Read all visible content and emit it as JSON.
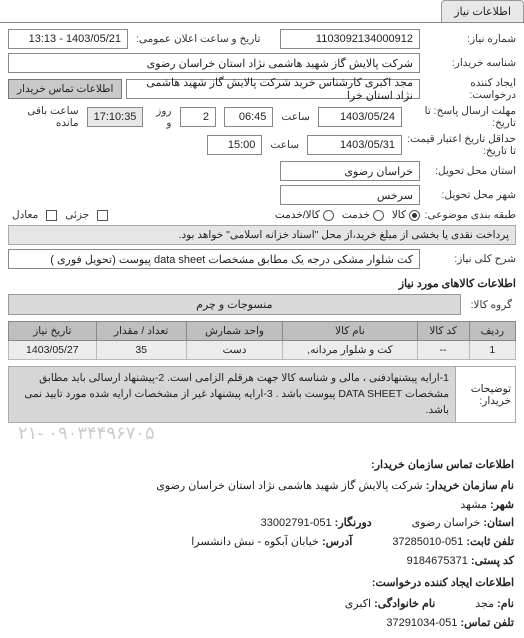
{
  "tab": {
    "label": "اطلاعات نیاز"
  },
  "form": {
    "need_no_label": "شماره نیاز:",
    "need_no": "1103092134000912",
    "announce_label": "تاریخ و ساعت اعلان عمومی:",
    "announce_value": "1403/05/21 - 13:13",
    "buyer_label": "شناسه خریدار:",
    "buyer": "شرکت پالایش گاز شهید هاشمی نژاد   استان خراسان رضوی",
    "requester_label": "ایجاد کننده درخواست:",
    "requester": "مجد اکبری کارشناس خرید شرکت پالایش گاز شهید هاشمی نژاد   استان خرا",
    "contact_btn": "اطلاعات تماس خریدار",
    "deadline_label": "مهلت ارسال پاسخ: تا تاریخ:",
    "deadline_date": "1403/05/24",
    "time_label": "ساعت",
    "deadline_time": "06:45",
    "days_remaining": "2",
    "days_and": "روز و",
    "remaining_time": "17:10:35",
    "remaining_label": "ساعت باقی مانده",
    "valid_label": "حداقل تاریخ اعتبار قیمت: تا تاریخ:",
    "valid_date": "1403/05/31",
    "valid_time": "15:00",
    "delivery_state_label": "استان محل تحویل:",
    "delivery_state": "خراسان رضوی",
    "delivery_city_label": "شهر محل تحویل:",
    "delivery_city": "سرخس",
    "topic_label": "طبقه بندی موضوعی:",
    "radios": {
      "goods": "کالا",
      "service": "خدمت",
      "both": "کالا/خدمت"
    },
    "partial_label": "جزئی",
    "equivalent_label": "معادل",
    "payment_note": "پرداخت نقدی یا بخشی از مبلغ خرید،از محل \"اسناد خزانه اسلامی\" خواهد بود.",
    "desc_key_label": "شرح کلی نیاز:",
    "desc_key": "کت شلوار مشکی درجه یک مطابق مشخصات data sheet پیوست (تحویل فوری )"
  },
  "goods_section": {
    "title": "اطلاعات کالاهای مورد نیاز",
    "group_label": "گروه کالا:",
    "group_value": "منسوجات و چرم"
  },
  "table": {
    "headers": [
      "ردیف",
      "کد کالا",
      "نام کالا",
      "واحد شمارش",
      "تعداد / مقدار",
      "تاریخ نیاز"
    ],
    "rows": [
      {
        "idx": "1",
        "code": "--",
        "name": "کت و شلوار مردانه,",
        "unit": "دست",
        "qty": "35",
        "date": "1403/05/27"
      }
    ]
  },
  "buyer_desc": {
    "label": "توضیحات خریدار:",
    "text": "1-ارایه پیشنهادفنی ، مالی و شناسه کالا جهت هرقلم الزامی است. 2-پیشنهاد ارسالی باید مطابق مشخصات DATA SHEET پیوست باشد . 3-ارایه پیشنهاد غیر از مشخصات ارایه شده مورد تایید نمی باشد."
  },
  "watermark": "۰۹۰۳۴۴۹۶۷۰۵ -۲۱",
  "contact": {
    "title": "اطلاعات تماس سازمان خریدار:",
    "org_label": "نام سازمان خریدار:",
    "org": "شرکت پالایش گاز شهید هاشمی نژاد استان خراسان رضوی",
    "city_label": "شهر:",
    "city": "مشهد",
    "province_label": "استان:",
    "province": "خراسان رضوی",
    "fax_label": "دورنگار:",
    "fax": "051-33002791",
    "phone_label": "تلفن ثابت:",
    "phone": "051-37285010",
    "address_label": "آدرس:",
    "address": "خیابان آبکوه - نبش دانشسرا",
    "postal_label": "کد پستی:",
    "postal": "9184675371",
    "requester_title": "اطلاعات ایجاد کننده درخواست:",
    "rfirst_label": "نام:",
    "rfirst": "مجد",
    "rlast_label": "نام خانوادگی:",
    "rlast": "اکبری",
    "rphone_label": "تلفن تماس:",
    "rphone": "051-37291034"
  }
}
